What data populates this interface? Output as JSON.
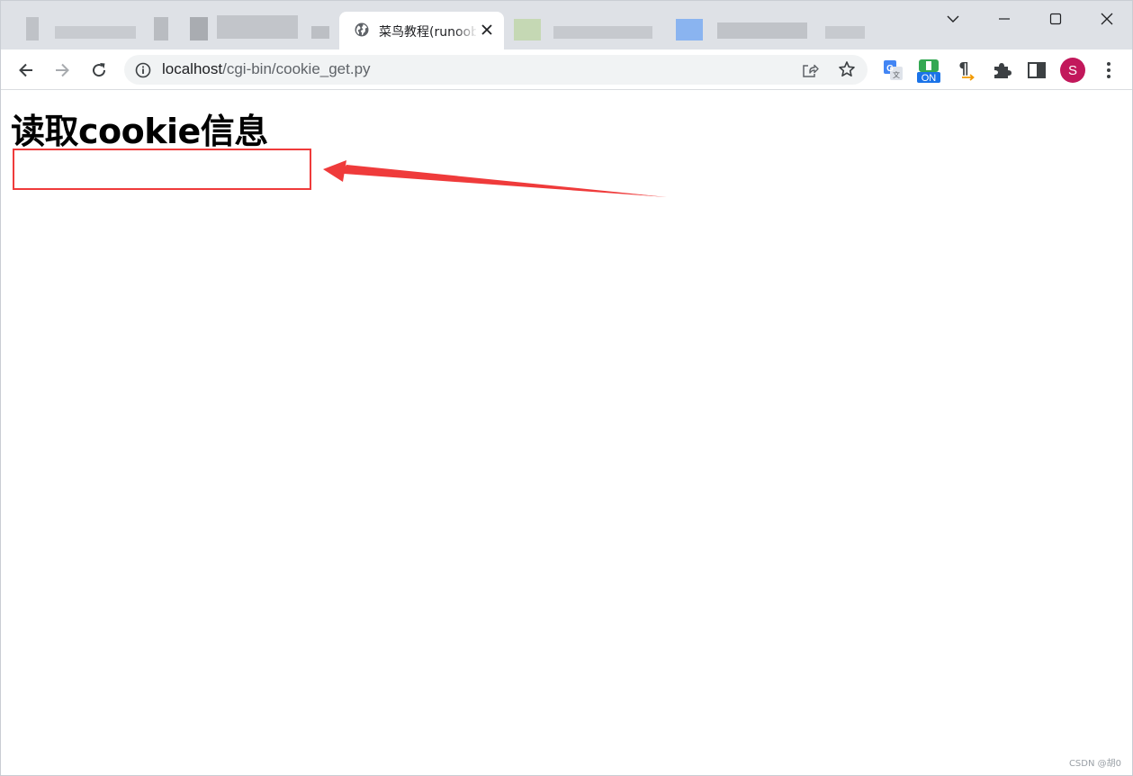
{
  "browser": {
    "active_tab": {
      "title": "菜鸟教程(runoob"
    },
    "address": {
      "host": "localhost",
      "path": "/cgi-bin/cookie_get.py"
    },
    "profile_initial": "S",
    "extensions": [
      {
        "icon": "google-translate-icon"
      },
      {
        "icon": "extension-on-badge-icon",
        "badge": "ON"
      },
      {
        "icon": "pilcrow-icon",
        "glyph": "¶"
      },
      {
        "icon": "puzzle-extensions-icon"
      },
      {
        "icon": "side-panel-icon"
      }
    ]
  },
  "page": {
    "heading": "读取cookie信息"
  },
  "annotation": {
    "box_color": "#ef3b3b",
    "arrow_color": "#ef3b3b"
  },
  "watermark": "CSDN @胡0"
}
